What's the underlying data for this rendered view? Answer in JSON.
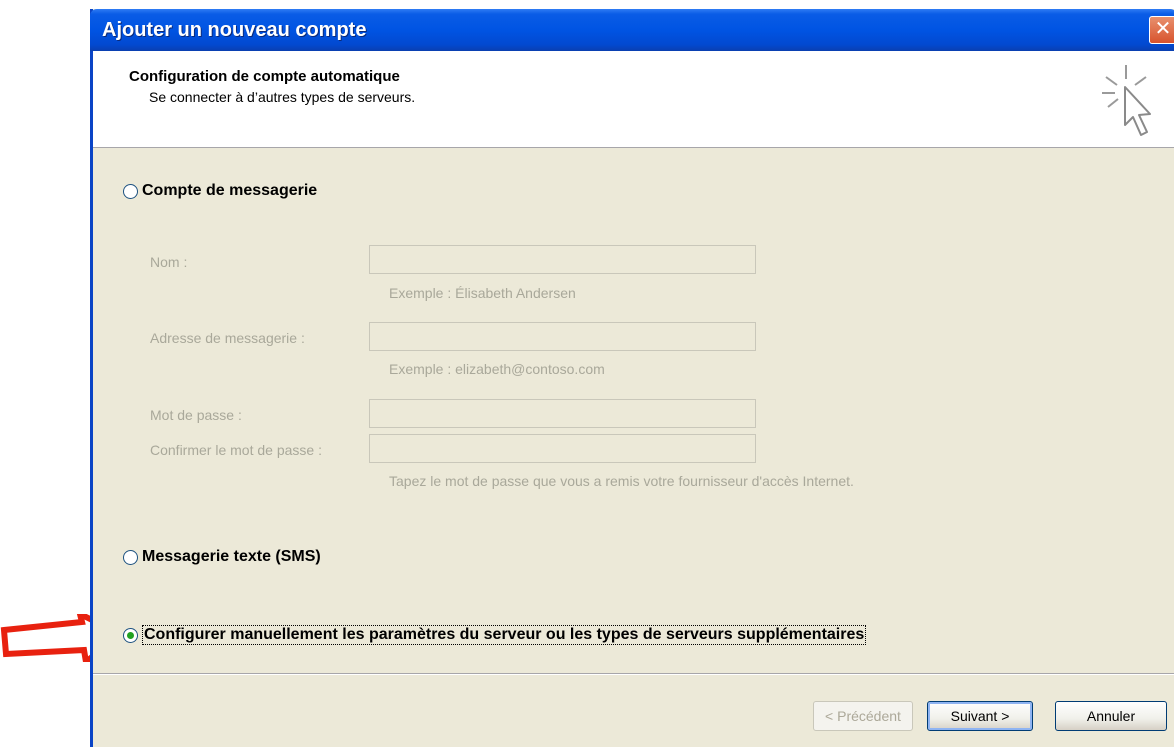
{
  "window": {
    "title": "Ajouter un nouveau compte",
    "close_glyph": "✕"
  },
  "header": {
    "title": "Configuration de compte automatique",
    "subtitle": "Se connecter à d’autres types de serveurs."
  },
  "options": {
    "email_account": "Compte de messagerie",
    "sms": "Messagerie texte (SMS)",
    "manual": "Configurer manuellement les paramètres du serveur ou les types de serveurs supplémentaires",
    "selected": "manual"
  },
  "fields": {
    "name_label": "Nom :",
    "name_value": "",
    "name_hint": "Exemple : Élisabeth Andersen",
    "email_label": "Adresse de messagerie :",
    "email_value": "",
    "email_hint": "Exemple : elizabeth@contoso.com",
    "password_label": "Mot de passe :",
    "password_value": "",
    "confirm_label": "Confirmer le mot de passe :",
    "confirm_value": "",
    "password_hint": "Tapez le mot de passe que vous a remis votre fournisseur d'accès Internet."
  },
  "buttons": {
    "back": "< Précédent",
    "next": "Suivant >",
    "cancel": "Annuler"
  },
  "annotations": {
    "arrow_color": "#e8210f"
  },
  "icons": {
    "header": "cursor-sparkle-icon",
    "close": "close-icon",
    "arrow": "red-arrow-icon"
  }
}
